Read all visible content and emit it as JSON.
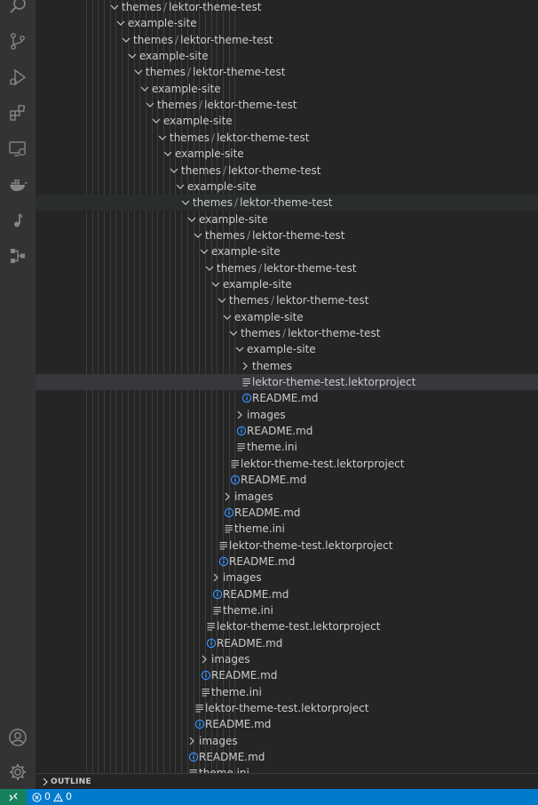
{
  "activity_bar": {
    "top_icons": [
      "search-icon",
      "source-control-icon",
      "run-debug-icon",
      "extensions-icon",
      "remote-explorer-icon",
      "docker-icon",
      "music-note-icon",
      "graph-nodes-icon"
    ],
    "bottom_icons": [
      "account-icon",
      "settings-gear-icon"
    ]
  },
  "colors": {
    "accent": "#007acc",
    "remote": "#16825d",
    "info": "#3794ff",
    "guide": "#3c3c3c"
  },
  "tree": [
    {
      "kind": "folder",
      "open": true,
      "depth": 0,
      "name": "themes/lektor-theme-test"
    },
    {
      "kind": "folder",
      "open": true,
      "depth": 1,
      "name": "example-site"
    },
    {
      "kind": "folder",
      "open": true,
      "depth": 2,
      "name": "themes/lektor-theme-test"
    },
    {
      "kind": "folder",
      "open": true,
      "depth": 3,
      "name": "example-site"
    },
    {
      "kind": "folder",
      "open": true,
      "depth": 4,
      "name": "themes/lektor-theme-test"
    },
    {
      "kind": "folder",
      "open": true,
      "depth": 5,
      "name": "example-site"
    },
    {
      "kind": "folder",
      "open": true,
      "depth": 6,
      "name": "themes/lektor-theme-test"
    },
    {
      "kind": "folder",
      "open": true,
      "depth": 7,
      "name": "example-site"
    },
    {
      "kind": "folder",
      "open": true,
      "depth": 8,
      "name": "themes/lektor-theme-test"
    },
    {
      "kind": "folder",
      "open": true,
      "depth": 9,
      "name": "example-site"
    },
    {
      "kind": "folder",
      "open": true,
      "depth": 10,
      "name": "themes/lektor-theme-test"
    },
    {
      "kind": "folder",
      "open": true,
      "depth": 11,
      "name": "example-site"
    },
    {
      "kind": "folder",
      "open": true,
      "depth": 12,
      "name": "themes/lektor-theme-test",
      "hover": true
    },
    {
      "kind": "folder",
      "open": true,
      "depth": 13,
      "name": "example-site"
    },
    {
      "kind": "folder",
      "open": true,
      "depth": 14,
      "name": "themes/lektor-theme-test"
    },
    {
      "kind": "folder",
      "open": true,
      "depth": 15,
      "name": "example-site"
    },
    {
      "kind": "folder",
      "open": true,
      "depth": 16,
      "name": "themes/lektor-theme-test"
    },
    {
      "kind": "folder",
      "open": true,
      "depth": 17,
      "name": "example-site"
    },
    {
      "kind": "folder",
      "open": true,
      "depth": 18,
      "name": "themes/lektor-theme-test"
    },
    {
      "kind": "folder",
      "open": true,
      "depth": 19,
      "name": "example-site"
    },
    {
      "kind": "folder",
      "open": true,
      "depth": 20,
      "name": "themes/lektor-theme-test"
    },
    {
      "kind": "folder",
      "open": true,
      "depth": 21,
      "name": "example-site"
    },
    {
      "kind": "folder",
      "open": false,
      "depth": 22,
      "name": "themes"
    },
    {
      "kind": "file",
      "icon": "lines",
      "depth": 22,
      "name": "lektor-theme-test.lektorproject",
      "selected": true
    },
    {
      "kind": "file",
      "icon": "info",
      "depth": 22,
      "name": "README.md"
    },
    {
      "kind": "folder",
      "open": false,
      "depth": 21,
      "name": "images"
    },
    {
      "kind": "file",
      "icon": "info",
      "depth": 21,
      "name": "README.md"
    },
    {
      "kind": "file",
      "icon": "lines",
      "depth": 21,
      "name": "theme.ini"
    },
    {
      "kind": "file",
      "icon": "lines",
      "depth": 20,
      "name": "lektor-theme-test.lektorproject"
    },
    {
      "kind": "file",
      "icon": "info",
      "depth": 20,
      "name": "README.md"
    },
    {
      "kind": "folder",
      "open": false,
      "depth": 19,
      "name": "images"
    },
    {
      "kind": "file",
      "icon": "info",
      "depth": 19,
      "name": "README.md"
    },
    {
      "kind": "file",
      "icon": "lines",
      "depth": 19,
      "name": "theme.ini"
    },
    {
      "kind": "file",
      "icon": "lines",
      "depth": 18,
      "name": "lektor-theme-test.lektorproject"
    },
    {
      "kind": "file",
      "icon": "info",
      "depth": 18,
      "name": "README.md"
    },
    {
      "kind": "folder",
      "open": false,
      "depth": 17,
      "name": "images"
    },
    {
      "kind": "file",
      "icon": "info",
      "depth": 17,
      "name": "README.md"
    },
    {
      "kind": "file",
      "icon": "lines",
      "depth": 17,
      "name": "theme.ini"
    },
    {
      "kind": "file",
      "icon": "lines",
      "depth": 16,
      "name": "lektor-theme-test.lektorproject"
    },
    {
      "kind": "file",
      "icon": "info",
      "depth": 16,
      "name": "README.md"
    },
    {
      "kind": "folder",
      "open": false,
      "depth": 15,
      "name": "images"
    },
    {
      "kind": "file",
      "icon": "info",
      "depth": 15,
      "name": "README.md"
    },
    {
      "kind": "file",
      "icon": "lines",
      "depth": 15,
      "name": "theme.ini"
    },
    {
      "kind": "file",
      "icon": "lines",
      "depth": 14,
      "name": "lektor-theme-test.lektorproject"
    },
    {
      "kind": "file",
      "icon": "info",
      "depth": 14,
      "name": "README.md"
    },
    {
      "kind": "folder",
      "open": false,
      "depth": 13,
      "name": "images"
    },
    {
      "kind": "file",
      "icon": "info",
      "depth": 13,
      "name": "README.md"
    },
    {
      "kind": "file",
      "icon": "lines",
      "depth": 13,
      "name": "theme.ini"
    }
  ],
  "outline": {
    "label": "OUTLINE"
  },
  "statusbar": {
    "errors": "0",
    "warnings": "0"
  }
}
